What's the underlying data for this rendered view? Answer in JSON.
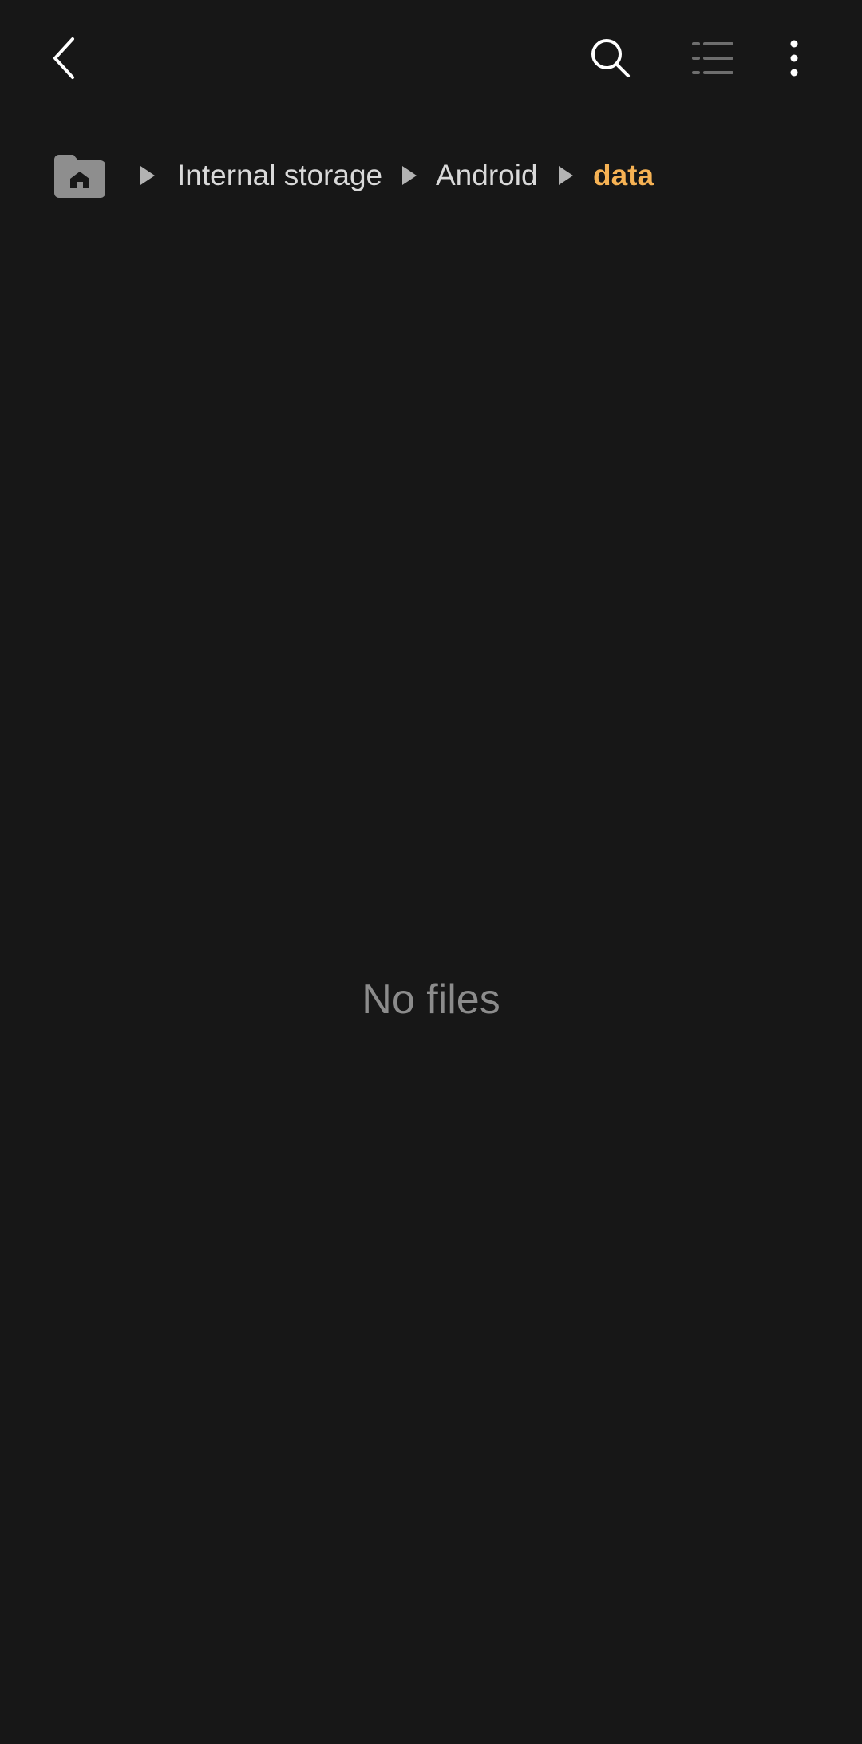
{
  "toolbar": {
    "back_icon": "chevron-left-icon",
    "search_icon": "search-icon",
    "list_view_icon": "list-view-icon",
    "more_icon": "more-vertical-icon"
  },
  "breadcrumb": {
    "home_icon": "home-folder-icon",
    "items": [
      {
        "label": "Internal storage"
      },
      {
        "label": "Android"
      },
      {
        "label": "data"
      }
    ]
  },
  "content": {
    "empty_message": "No files"
  },
  "colors": {
    "background": "#171717",
    "current_crumb": "#f6b254",
    "crumb_text": "#d9d9d9",
    "empty_text": "#8c8c8c",
    "icon": "#ffffff"
  }
}
